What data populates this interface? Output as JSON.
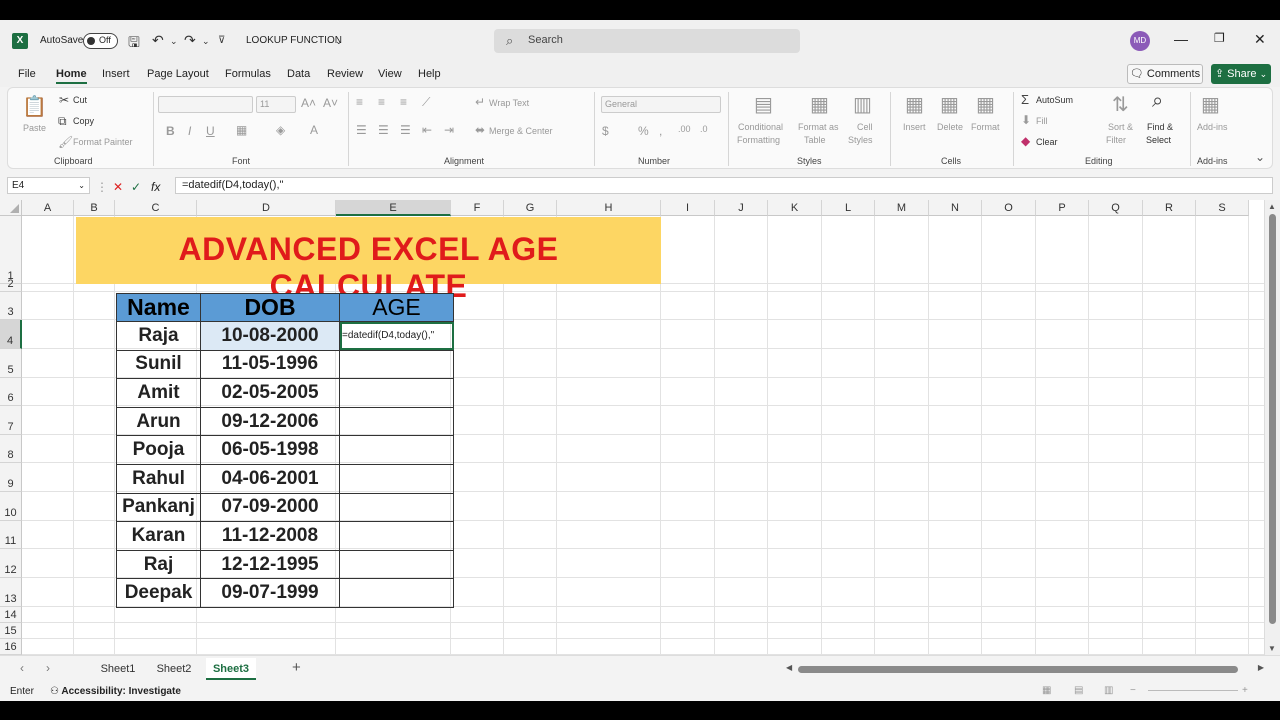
{
  "app": {
    "logo_letter": "X",
    "autosave_label": "AutoSave",
    "autosave_state": "Off",
    "doc_title": "LOOKUP FUNCTION",
    "search_placeholder": "Search",
    "user_initials": "MD"
  },
  "menu": {
    "tabs": [
      "File",
      "Home",
      "Insert",
      "Page Layout",
      "Formulas",
      "Data",
      "Review",
      "View",
      "Help"
    ],
    "active": "Home",
    "comments_label": "Comments",
    "share_label": "Share"
  },
  "ribbon": {
    "clipboard": {
      "paste": "Paste",
      "cut": "Cut",
      "copy": "Copy",
      "format_painter": "Format Painter",
      "label": "Clipboard"
    },
    "font": {
      "size": "11",
      "label": "Font",
      "bold": "B",
      "italic": "I",
      "underline": "U"
    },
    "alignment": {
      "wrap_text": "Wrap Text",
      "merge_center": "Merge & Center",
      "label": "Alignment"
    },
    "number": {
      "format": "General",
      "label": "Number"
    },
    "styles": {
      "conditional_1": "Conditional",
      "conditional_2": "Formatting",
      "format_table_1": "Format as",
      "format_table_2": "Table",
      "cell_styles_1": "Cell",
      "cell_styles_2": "Styles",
      "label": "Styles"
    },
    "cells": {
      "insert": "Insert",
      "delete": "Delete",
      "format": "Format",
      "label": "Cells"
    },
    "editing": {
      "autosum": "AutoSum",
      "fill": "Fill",
      "clear": "Clear",
      "sort_1": "Sort &",
      "sort_2": "Filter",
      "find_1": "Find &",
      "find_2": "Select",
      "label": "Editing"
    },
    "addins": {
      "name": "Add-ins",
      "label": "Add-ins"
    }
  },
  "formula_bar": {
    "cell_ref": "E4",
    "fx": "fx",
    "formula": "=datedif(D4,today(),\""
  },
  "grid": {
    "columns": [
      "A",
      "B",
      "C",
      "D",
      "E",
      "F",
      "G",
      "H",
      "I",
      "J",
      "K",
      "L",
      "M",
      "N",
      "O",
      "P",
      "Q",
      "R",
      "S"
    ],
    "rows": [
      "1",
      "2",
      "3",
      "4",
      "5",
      "6",
      "7",
      "8",
      "9",
      "10",
      "11",
      "12",
      "13",
      "14",
      "15",
      "16"
    ],
    "selected_column": "E",
    "selected_row": "4"
  },
  "sheet": {
    "title": "ADVANCED EXCEL AGE CALCULATE",
    "headers": {
      "name": "Name",
      "dob": "DOB",
      "age": "AGE"
    },
    "records": [
      {
        "name": "Raja",
        "dob": "10-08-2000"
      },
      {
        "name": "Sunil",
        "dob": "11-05-1996"
      },
      {
        "name": "Amit",
        "dob": "02-05-2005"
      },
      {
        "name": "Arun",
        "dob": "09-12-2006"
      },
      {
        "name": "Pooja",
        "dob": "06-05-1998"
      },
      {
        "name": "Rahul",
        "dob": "04-06-2001"
      },
      {
        "name": "Pankanj",
        "dob": "07-09-2000"
      },
      {
        "name": "Karan",
        "dob": "11-12-2008"
      },
      {
        "name": "Raj",
        "dob": "12-12-1995"
      },
      {
        "name": "Deepak",
        "dob": "09-07-1999"
      }
    ],
    "active_cell_text": "=datedif(D4,today(),\""
  },
  "sheet_tabs": {
    "tabs": [
      "Sheet1",
      "Sheet2",
      "Sheet3"
    ],
    "active": "Sheet3",
    "add": "+"
  },
  "status": {
    "mode": "Enter",
    "accessibility": "Accessibility: Investigate"
  },
  "colors": {
    "excel_green": "#1d6f42",
    "banner": "#fdd663",
    "title_red": "#e01b1b",
    "header_blue": "#5b9bd5"
  }
}
